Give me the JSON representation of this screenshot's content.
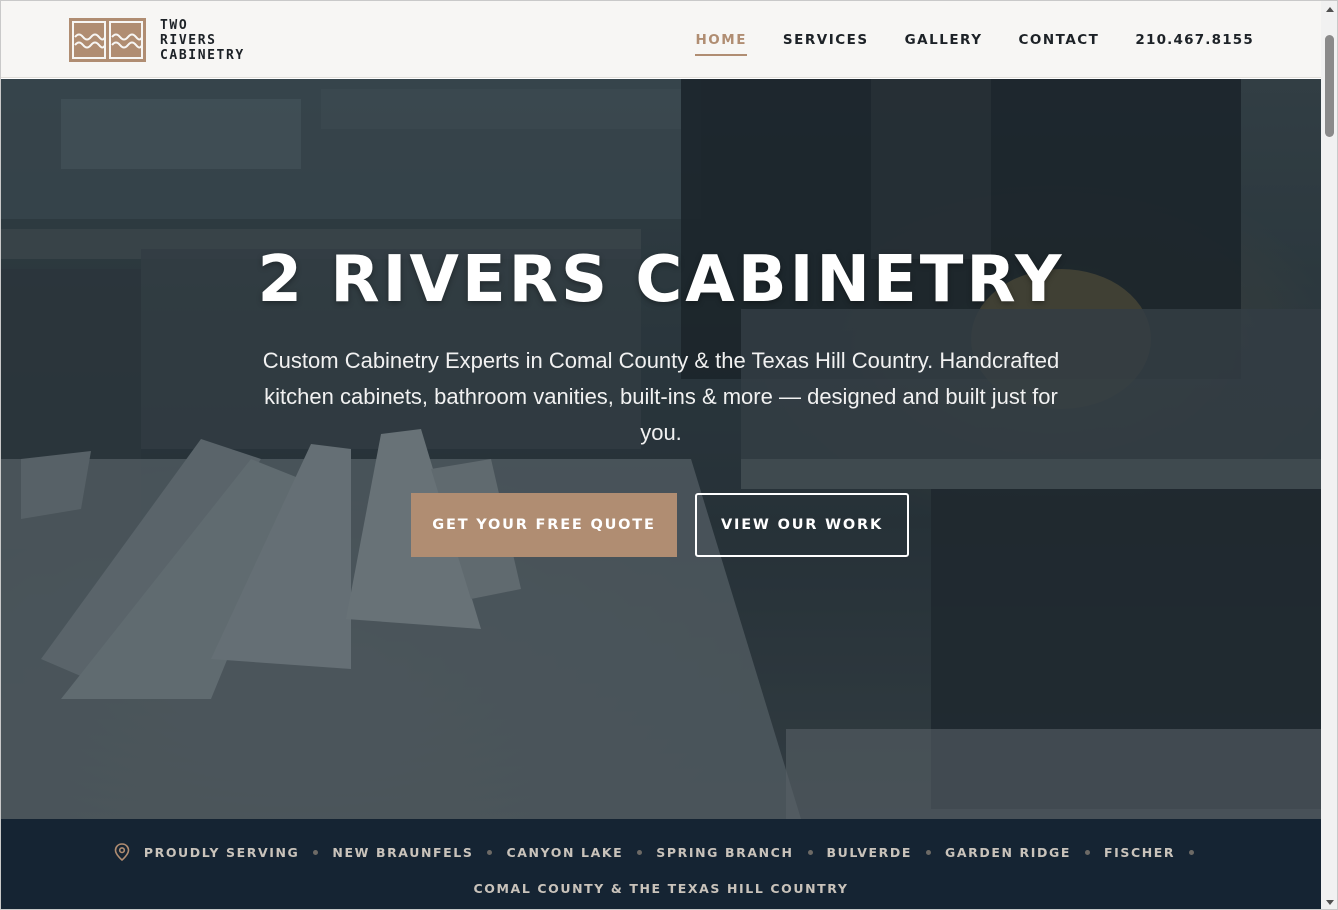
{
  "header": {
    "logo": {
      "icon": "two-rivers-wave-logo-icon",
      "lines": [
        "TWO",
        "RIVERS",
        "CABINETRY"
      ],
      "color": "#b08d72"
    },
    "nav": [
      {
        "label": "HOME",
        "active": true
      },
      {
        "label": "SERVICES",
        "active": false
      },
      {
        "label": "GALLERY",
        "active": false
      },
      {
        "label": "CONTACT",
        "active": false
      },
      {
        "label": "210.467.8155",
        "active": false
      }
    ]
  },
  "hero": {
    "title": "2 RIVERS CABINETRY",
    "subtitle": "Custom Cabinetry Experts in Comal County & the Texas Hill Country. Handcrafted kitchen cabinets, bathroom vanities, built-ins & more — designed and built just for you.",
    "primary_button": "GET YOUR FREE QUOTE",
    "secondary_button": "VIEW OUR WORK",
    "accent_color": "#b08d72"
  },
  "service_area": {
    "icon": "map-pin-icon",
    "lead": "PROUDLY SERVING",
    "cities": [
      "NEW BRAUNFELS",
      "CANYON LAKE",
      "SPRING BRANCH",
      "BULVERDE",
      "GARDEN RIDGE",
      "FISCHER"
    ],
    "region": "COMAL COUNTY & THE TEXAS HILL COUNTRY",
    "background": "#152433"
  }
}
